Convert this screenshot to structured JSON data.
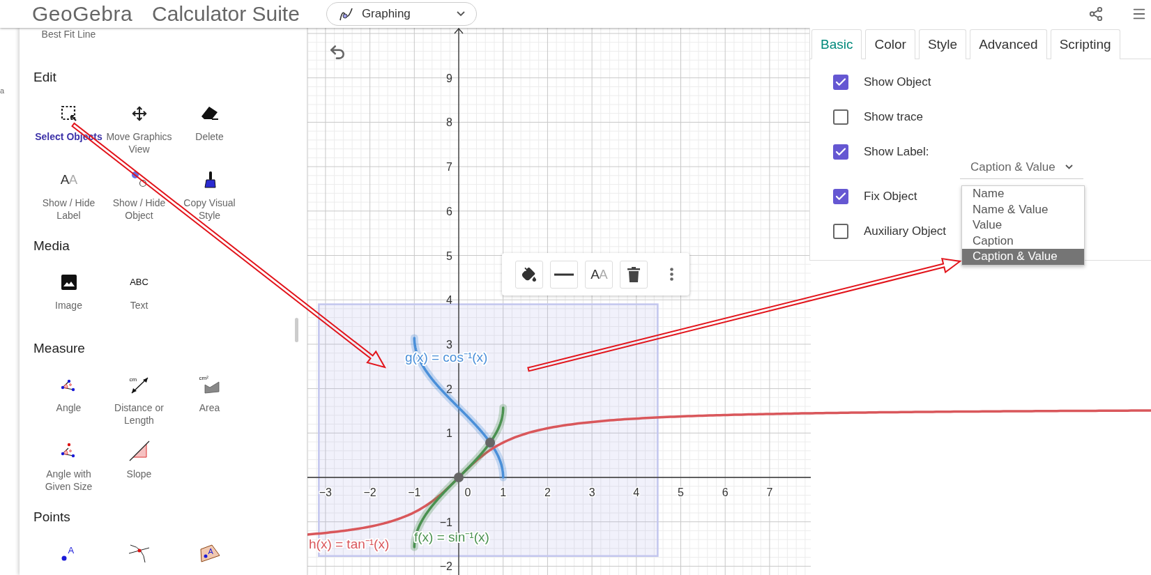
{
  "header": {
    "logo": "GeoGebra",
    "title": "Calculator Suite",
    "app_picker": "Graphing"
  },
  "side_strip": {
    "text": "a"
  },
  "tools_panel": {
    "top_label": "Best Fit Line",
    "sections": [
      {
        "title": "Edit",
        "tools": [
          {
            "label": "Select Objects",
            "kind": "select",
            "selected": true
          },
          {
            "label": "Move Graphics View",
            "kind": "move",
            "selected": false
          },
          {
            "label": "Delete",
            "kind": "delete",
            "selected": false
          },
          {
            "label": "Show / Hide Label",
            "kind": "label",
            "glyph": [
              "A",
              "A"
            ],
            "selected": false
          },
          {
            "label": "Show / Hide Object",
            "kind": "showhide",
            "selected": false
          },
          {
            "label": "Copy Visual Style",
            "kind": "copystyle",
            "selected": false
          }
        ]
      },
      {
        "title": "Media",
        "tools": [
          {
            "label": "Image",
            "kind": "image",
            "selected": false
          },
          {
            "label": "Text",
            "kind": "text",
            "glyph": "ABC",
            "selected": false
          }
        ]
      },
      {
        "title": "Measure",
        "tools": [
          {
            "label": "Angle",
            "kind": "angle",
            "selected": false
          },
          {
            "label": "Distance or Length",
            "kind": "distance",
            "glyph": "cm",
            "selected": false
          },
          {
            "label": "Area",
            "kind": "area",
            "glyph": "cm²",
            "selected": false
          },
          {
            "label": "Angle with Given Size",
            "kind": "anglesize",
            "selected": false
          },
          {
            "label": "Slope",
            "kind": "slope",
            "selected": false
          }
        ]
      },
      {
        "title": "Points",
        "tools": [
          {
            "kind": "point",
            "glyph": "A"
          },
          {
            "kind": "intersect"
          },
          {
            "kind": "pointonobject",
            "glyph": "A"
          }
        ]
      }
    ]
  },
  "graph": {
    "x_ticks": [
      "−3",
      "−2",
      "−1",
      "0",
      "1",
      "2",
      "3",
      "4",
      "5",
      "6",
      "7"
    ],
    "y_ticks": [
      "9",
      "8",
      "7",
      "6",
      "5",
      "4",
      "3",
      "2",
      "1",
      "−1",
      "−2"
    ],
    "functions": [
      {
        "label": "g(x) = cos⁻¹(x)",
        "kind": "acos",
        "color": "#4a8fd9"
      },
      {
        "label": "h(x) = tan⁻¹(x)",
        "kind": "atan",
        "color": "#d9575b"
      },
      {
        "label": "f(x) = sin⁻¹(x)",
        "kind": "asin",
        "color": "#4a9150"
      }
    ],
    "style_bar": [
      {
        "kind": "fill"
      },
      {
        "kind": "line"
      },
      {
        "kind": "label",
        "glyph": [
          "A",
          "A"
        ]
      },
      {
        "kind": "delete"
      },
      {
        "kind": "more"
      }
    ]
  },
  "properties": {
    "tabs": [
      {
        "label": "Basic",
        "selected": true
      },
      {
        "label": "Color",
        "selected": false
      },
      {
        "label": "Style",
        "selected": false
      },
      {
        "label": "Advanced",
        "selected": false
      },
      {
        "label": "Scripting",
        "selected": false
      }
    ],
    "options": [
      {
        "label": "Show Object",
        "checked": true,
        "kind": "checkbox"
      },
      {
        "label": "Show trace",
        "checked": false,
        "kind": "checkbox"
      },
      {
        "label": "Show Label:",
        "checked": true,
        "kind": "checkbox_select"
      },
      {
        "label": "Fix Object",
        "checked": true,
        "kind": "checkbox"
      },
      {
        "label": "Auxiliary Object",
        "checked": false,
        "kind": "checkbox"
      }
    ],
    "label_select": {
      "value": "Caption & Value",
      "options": [
        {
          "label": "Name",
          "selected": false
        },
        {
          "label": "Name & Value",
          "selected": false
        },
        {
          "label": "Value",
          "selected": false
        },
        {
          "label": "Caption",
          "selected": false
        },
        {
          "label": "Caption & Value",
          "selected": true
        }
      ]
    }
  }
}
